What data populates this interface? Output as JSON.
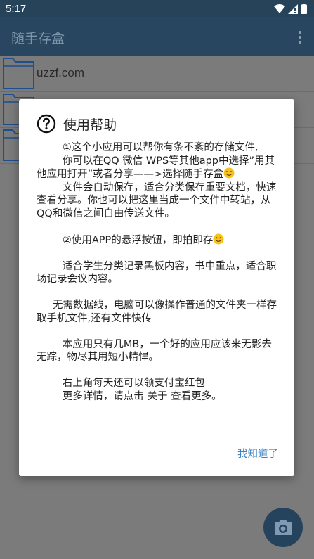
{
  "status_bar": {
    "time": "5:17"
  },
  "app_bar": {
    "title": "随手存盒"
  },
  "list": {
    "items": [
      {
        "label": "uzzf.com"
      },
      {
        "label": ""
      },
      {
        "label": ""
      }
    ]
  },
  "dialog": {
    "title": "使用帮助",
    "paragraphs": {
      "p1_line1": "        ①这个小应用可以帮你有条不紊的存储文件,",
      "p1_line2": "        你可以在QQ 微信 WPS等其他app中选择”用其他应用打开”或者分享——>选择随手存盒",
      "p1_line3": "        文件会自动保存，适合分类保存重要文档，快速查看分享。你也可以把这里当成一个文件中转站，从QQ和微信之间自由传送文件。",
      "p2": "        ②使用APP的悬浮按钮，即拍即存",
      "p3": "        适合学生分类记录黑板内容，书中重点，适合职场记录会议内容。",
      "p4": "     无需数据线，电脑可以像操作普通的文件夹一样存取手机文件,还有文件快传",
      "p5": "        本应用只有几MB，一个好的应用应该来无影去无踪，物尽其用短小精悍。",
      "p6_line1": "        右上角每天还可以领支付宝红包",
      "p6_line2": "        更多详情，请点击 关于 查看更多。"
    },
    "ok_label": "我知道了"
  },
  "colors": {
    "app_bar": "#28465f",
    "link": "#3b82c4",
    "fab": "#25435d"
  }
}
